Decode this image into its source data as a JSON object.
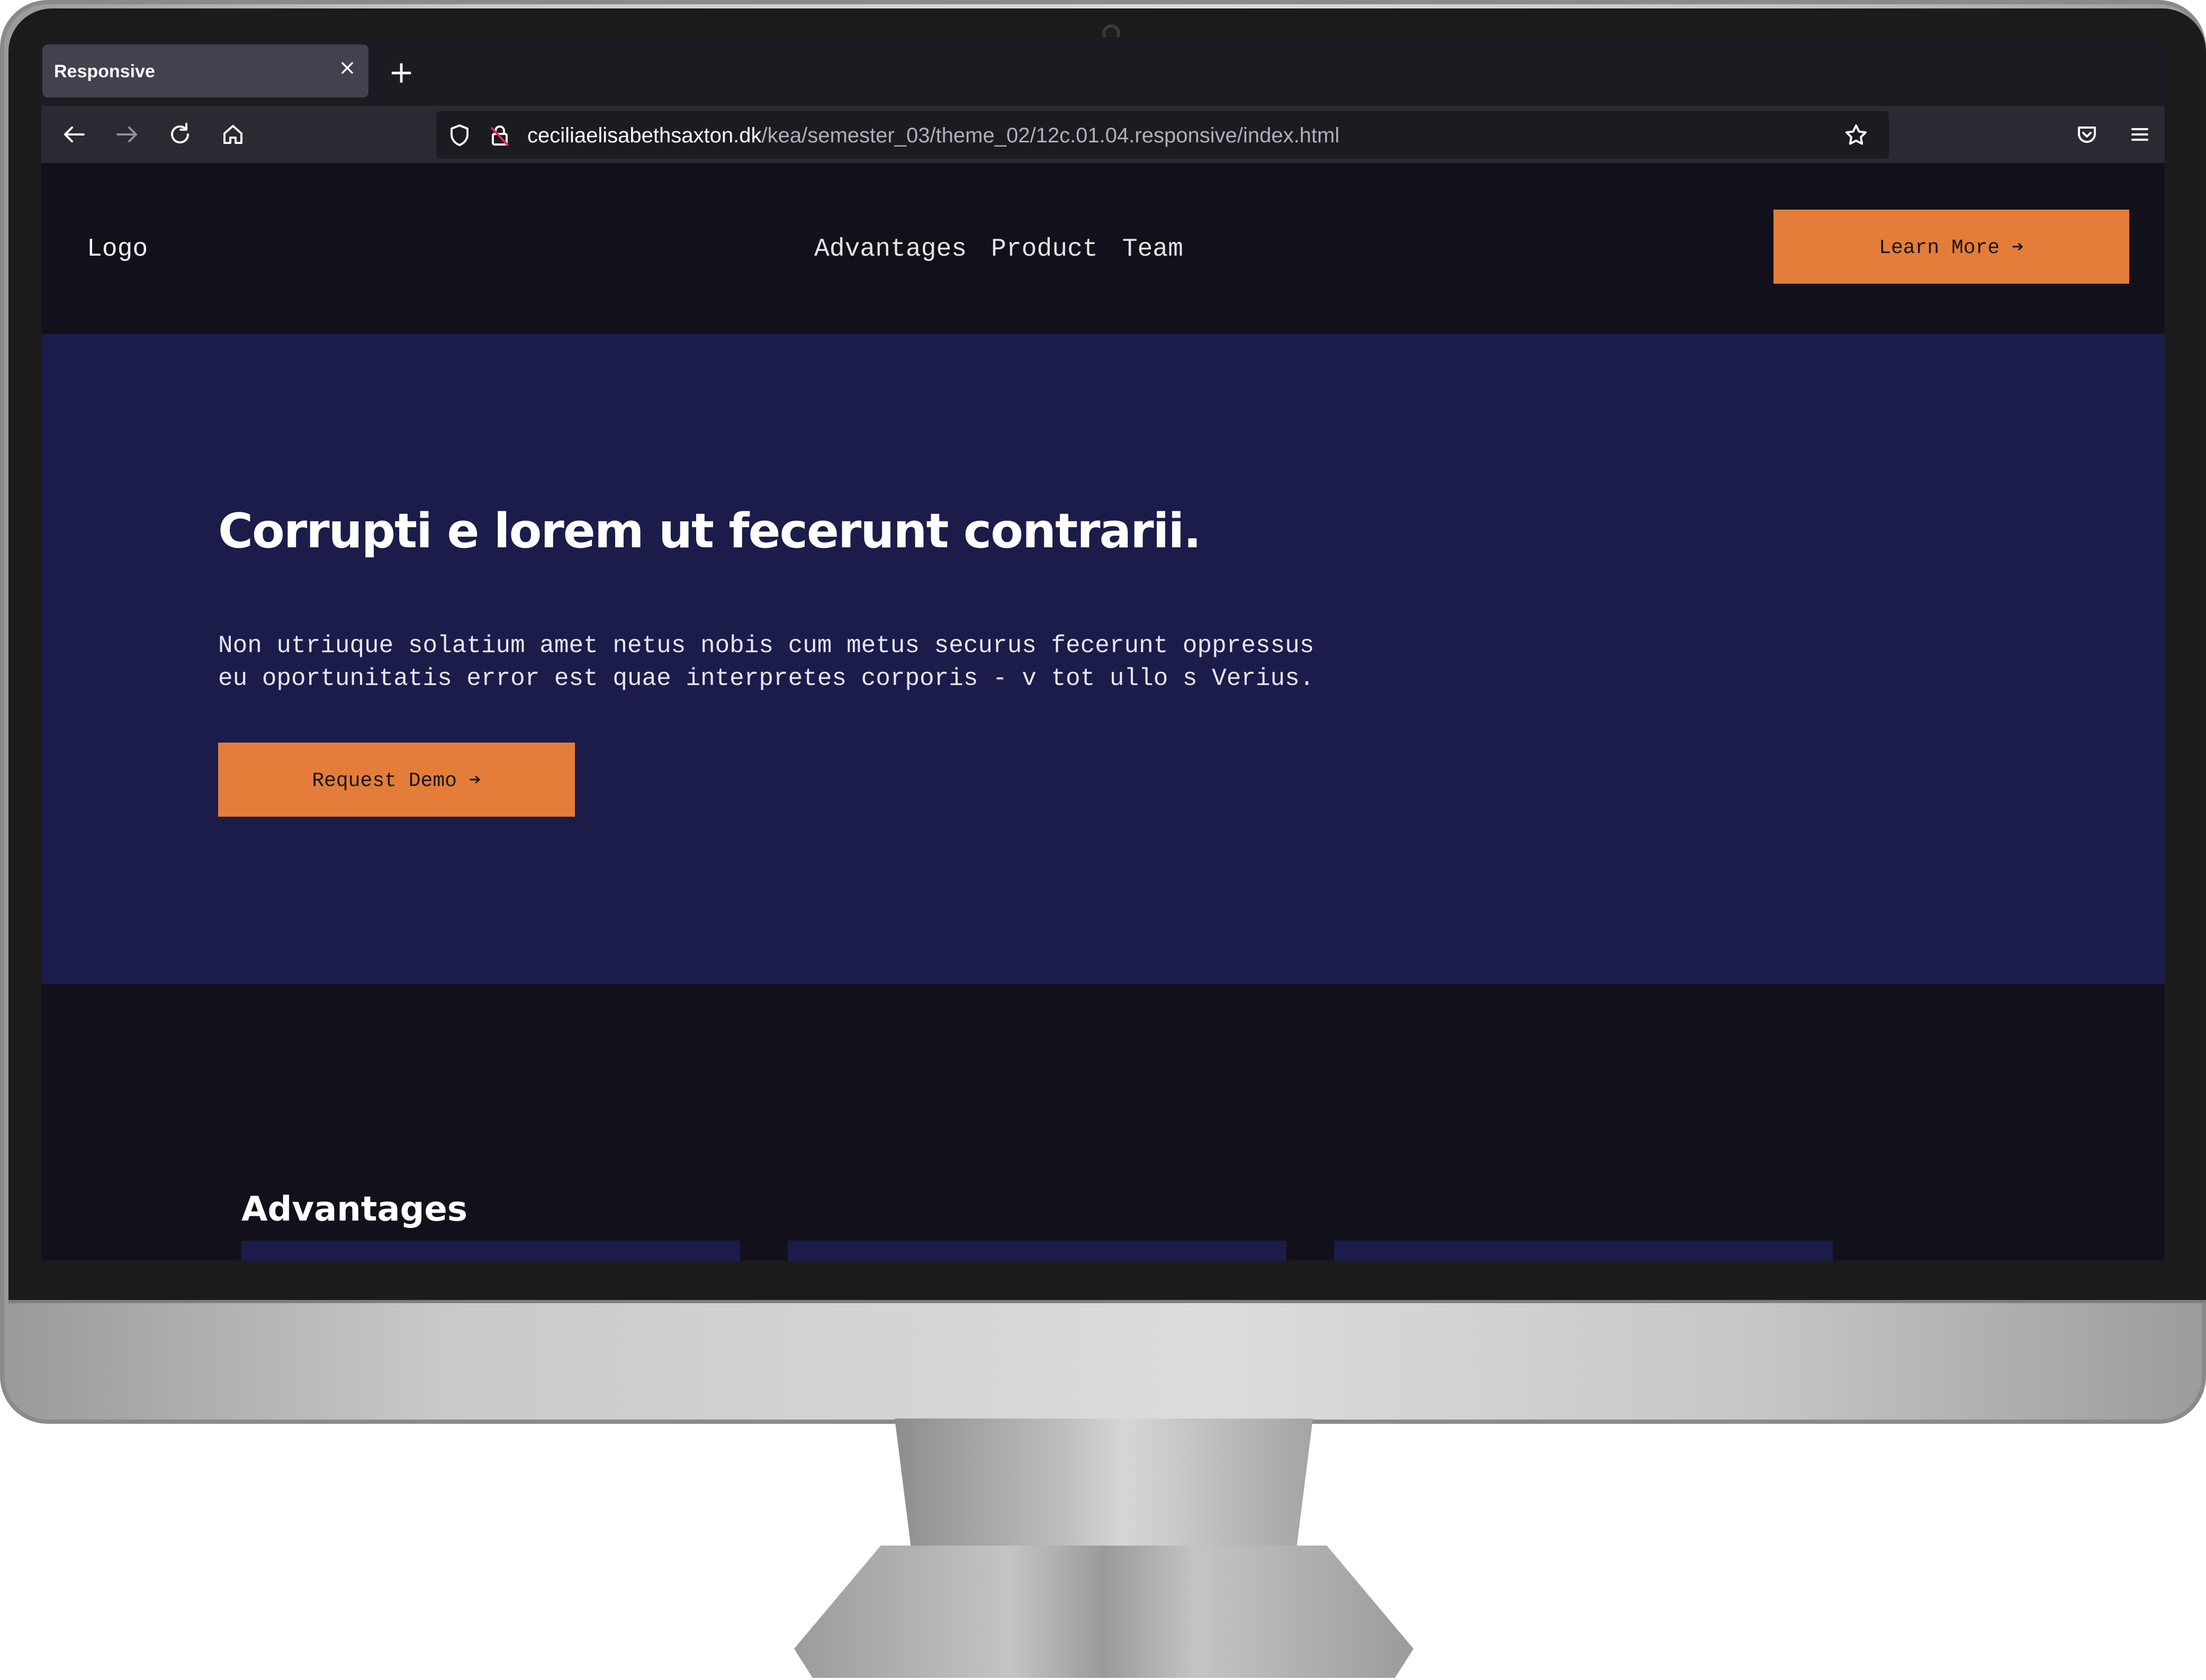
{
  "browser": {
    "tab_title": "Responsive",
    "tab_close": "×",
    "new_tab": "+",
    "url_host": "ceciliaelisabethsaxton.dk",
    "url_path": "/kea/semester_03/theme_02/12c.01.04.responsive/index.html",
    "icons": [
      "back-icon",
      "forward-icon",
      "reload-icon",
      "home-icon",
      "shield-icon",
      "insecure-lock-icon",
      "bookmark-star-icon",
      "pocket-icon",
      "menu-icon"
    ]
  },
  "site": {
    "logo": "Logo",
    "nav": [
      "Advantages",
      "Product",
      "Team"
    ],
    "header_cta": "Learn More ➔",
    "hero": {
      "title": "Corrupti e lorem ut fecerunt contrarii.",
      "body": "Non utriuque solatium amet netus nobis cum metus securus fecerunt oppressus eu oportunitatis error est quae interpretes corporis - v tot ullo s Verius.",
      "cta": "Request Demo ➔"
    },
    "advantages_title": "Advantages"
  },
  "colors": {
    "accent": "#e47d3a",
    "hero_bg": "#1b1c4a",
    "page_bg": "#12111b"
  }
}
